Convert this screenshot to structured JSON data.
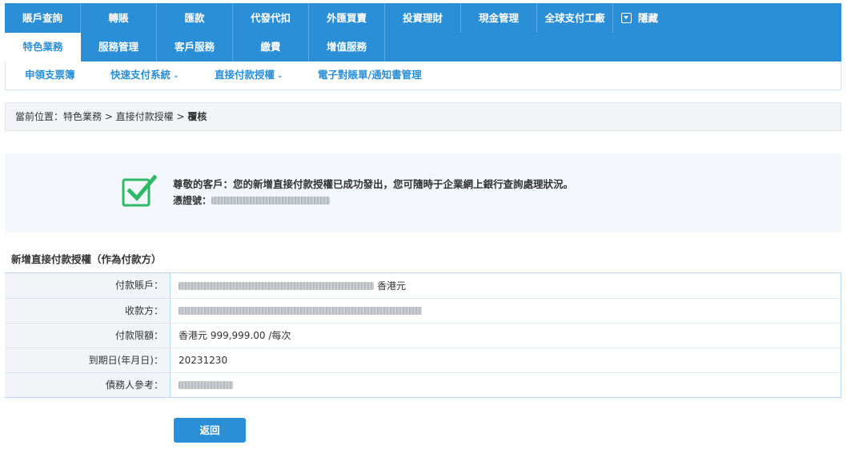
{
  "nav_primary": [
    {
      "label": "賬戶查詢"
    },
    {
      "label": "轉賬"
    },
    {
      "label": "匯款"
    },
    {
      "label": "代發代扣"
    },
    {
      "label": "外匯買賣"
    },
    {
      "label": "投資理財"
    },
    {
      "label": "現金管理"
    },
    {
      "label": "全球支付工廠"
    }
  ],
  "nav_hide_label": "隱藏",
  "nav_secondary": [
    {
      "label": "特色業務",
      "active": true
    },
    {
      "label": "服務管理"
    },
    {
      "label": "客戶服務"
    },
    {
      "label": "繳費"
    },
    {
      "label": "增值服務"
    }
  ],
  "nav_tertiary": [
    {
      "label": "申領支票簿",
      "dropdown": false
    },
    {
      "label": "快速支付系統",
      "dropdown": true
    },
    {
      "label": "直接付款授權",
      "dropdown": true
    },
    {
      "label": "電子對賬單/通知書管理",
      "dropdown": false
    }
  ],
  "breadcrumb": {
    "prefix": "當前位置：特色業務 > 直接付款授權 > ",
    "current": "覆核"
  },
  "success": {
    "message": "尊敬的客戶：您的新增直接付款授權已成功發出，您可隨時于企業網上銀行查詢處理狀況。",
    "ref_label": "憑證號：",
    "icon": "green-checkbox-icon"
  },
  "section_title": "新增直接付款授權（作為付款方）",
  "details": [
    {
      "label": "付款賬戶：",
      "value": "",
      "suffix": "香港元",
      "redacted": true
    },
    {
      "label": "收款方：",
      "value": "",
      "suffix": "",
      "redacted": true
    },
    {
      "label": "付款限額：",
      "value": "香港元 999,999.00 /每次",
      "suffix": "",
      "redacted": false
    },
    {
      "label": "到期日(年月日)：",
      "value": "20231230",
      "suffix": "",
      "redacted": false
    },
    {
      "label": "債務人參考：",
      "value": "",
      "suffix": "",
      "redacted": true
    }
  ],
  "return_button": "返回",
  "colors": {
    "primary": "#2a8fd6",
    "success_green": "#2fb866",
    "panel_bg": "#f3f6fa"
  }
}
